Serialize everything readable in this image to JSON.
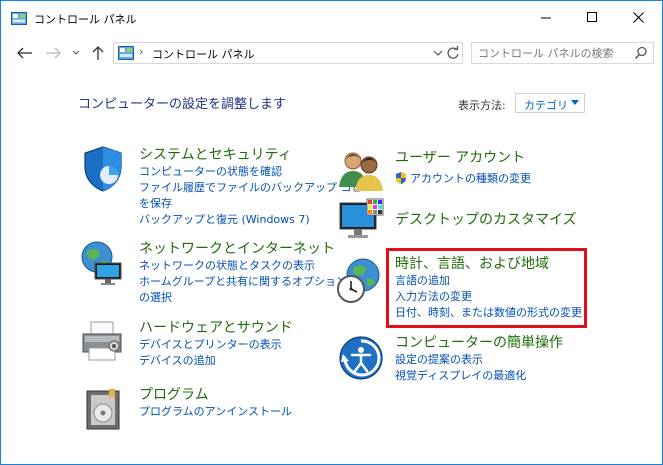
{
  "window": {
    "title": "コントロール パネル"
  },
  "address": {
    "path": "コントロール パネル",
    "separator": "›"
  },
  "search": {
    "placeholder": "コントロール パネルの検索"
  },
  "header": {
    "heading": "コンピューターの設定を調整します",
    "view_label": "表示方法:",
    "view_value": "カテゴリ"
  },
  "categories": {
    "system": {
      "title": "システムとセキュリティ",
      "links": [
        "コンピューターの状態を確認",
        "ファイル履歴でファイルのバックアップ コピー",
        "を保存",
        "バックアップと復元 (Windows 7)"
      ]
    },
    "network": {
      "title": "ネットワークとインターネット",
      "links": [
        "ネットワークの状態とタスクの表示",
        "ホームグループと共有に関するオプション",
        "の選択"
      ]
    },
    "hardware": {
      "title": "ハードウェアとサウンド",
      "links": [
        "デバイスとプリンターの表示",
        "デバイスの追加"
      ]
    },
    "programs": {
      "title": "プログラム",
      "links": [
        "プログラムのアンインストール"
      ]
    },
    "users": {
      "title": "ユーザー アカウント",
      "links": [
        "アカウントの種類の変更"
      ]
    },
    "appearance": {
      "title": "デスクトップのカスタマイズ",
      "links": []
    },
    "clock": {
      "title": "時計、言語、および地域",
      "links": [
        "言語の追加",
        "入力方法の変更",
        "日付、時刻、または数値の形式の変更"
      ]
    },
    "ease": {
      "title": "コンピューターの簡単操作",
      "links": [
        "設定の提案の表示",
        "視覚ディスプレイの最適化"
      ]
    }
  },
  "colors": {
    "accent_border": "#1883d7",
    "category_title": "#1f6d0a",
    "link": "#0050b5",
    "heading": "#1e3287",
    "highlight": "#e3101a"
  }
}
